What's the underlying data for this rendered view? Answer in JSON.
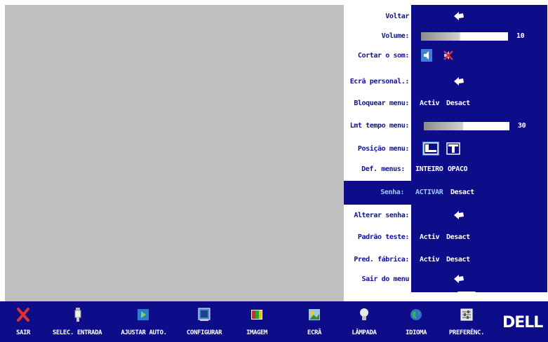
{
  "menu": {
    "back": "Voltar",
    "volume": {
      "label": "Volume:",
      "value": "10",
      "level": 0.46
    },
    "mute": {
      "label": "Cortar o som:"
    },
    "custom_screen": "Ecrã personal.:",
    "lock_menu": {
      "label": "Bloquear menu:",
      "on": "Activ",
      "off": "Desact"
    },
    "menu_timeout": {
      "label": "Lmt tempo menu:",
      "value": "30",
      "level": 0.47
    },
    "menu_position": {
      "label": "Posição menu:"
    },
    "menu_def": {
      "label": "Def. menus:",
      "opt1": "INTEIRO",
      "opt2": "OPACO"
    },
    "password": {
      "label": "Senha:",
      "opt1": "ACTIVAR",
      "opt2": "Desact"
    },
    "change_password": "Alterar senha:",
    "test_pattern": {
      "label": "Padrão teste:",
      "on": "Activ",
      "off": "Desact"
    },
    "factory_reset": {
      "label": "Pred. fábrica:",
      "on": "Activ",
      "off": "Desact"
    },
    "exit_menu": "Sair do menu"
  },
  "toolbar": {
    "items": [
      "SAIR",
      "SELEC. ENTRADA",
      "AJUSTAR AUTO.",
      "CONFIGURAR",
      "IMAGEM",
      "ECRÃ",
      "LÂMPADA",
      "IDIOMA",
      "PREFERÊNC."
    ],
    "logo": "DELL"
  },
  "colors": {
    "menu_bg": "#0d0d8a",
    "label": "#111199",
    "selected_label": "#9fc6ff",
    "screen": "#c0c0c0"
  }
}
